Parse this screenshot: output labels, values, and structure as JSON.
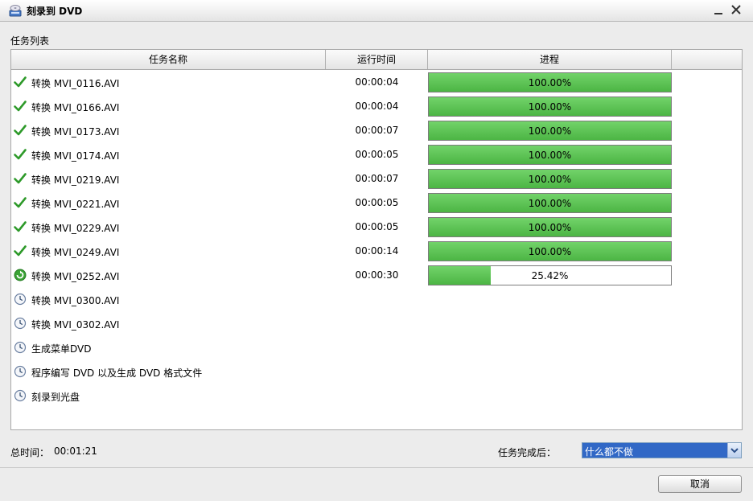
{
  "window": {
    "title": "刻录到 DVD"
  },
  "task_list": {
    "label": "任务列表",
    "columns": [
      "任务名称",
      "运行时间",
      "进程",
      ""
    ],
    "rows": [
      {
        "status": "done-check-icon",
        "name": "转换 MVI_0116.AVI",
        "time": "00:00:04",
        "progress": 100,
        "progress_text": "100.00%"
      },
      {
        "status": "done-check-icon",
        "name": "转换 MVI_0166.AVI",
        "time": "00:00:04",
        "progress": 100,
        "progress_text": "100.00%"
      },
      {
        "status": "done-check-icon",
        "name": "转换 MVI_0173.AVI",
        "time": "00:00:07",
        "progress": 100,
        "progress_text": "100.00%"
      },
      {
        "status": "done-check-icon",
        "name": "转换 MVI_0174.AVI",
        "time": "00:00:05",
        "progress": 100,
        "progress_text": "100.00%"
      },
      {
        "status": "done-check-icon",
        "name": "转换 MVI_0219.AVI",
        "time": "00:00:07",
        "progress": 100,
        "progress_text": "100.00%"
      },
      {
        "status": "done-check-icon",
        "name": "转换 MVI_0221.AVI",
        "time": "00:00:05",
        "progress": 100,
        "progress_text": "100.00%"
      },
      {
        "status": "done-check-icon",
        "name": "转换 MVI_0229.AVI",
        "time": "00:00:05",
        "progress": 100,
        "progress_text": "100.00%"
      },
      {
        "status": "done-check-icon",
        "name": "转换 MVI_0249.AVI",
        "time": "00:00:14",
        "progress": 100,
        "progress_text": "100.00%"
      },
      {
        "status": "running-refresh-icon",
        "name": "转换 MVI_0252.AVI",
        "time": "00:00:30",
        "progress": 25.42,
        "progress_text": "25.42%"
      },
      {
        "status": "pending-clock-icon",
        "name": "转换 MVI_0300.AVI",
        "time": "",
        "progress": null,
        "progress_text": ""
      },
      {
        "status": "pending-clock-icon",
        "name": "转换 MVI_0302.AVI",
        "time": "",
        "progress": null,
        "progress_text": ""
      },
      {
        "status": "pending-clock-icon",
        "name": "生成菜单DVD",
        "time": "",
        "progress": null,
        "progress_text": ""
      },
      {
        "status": "pending-clock-icon",
        "name": "程序编写 DVD 以及生成 DVD 格式文件",
        "time": "",
        "progress": null,
        "progress_text": ""
      },
      {
        "status": "pending-clock-icon",
        "name": "刻录到光盘",
        "time": "",
        "progress": null,
        "progress_text": ""
      }
    ]
  },
  "footer": {
    "total_label": "总时间：",
    "total_value": "00:01:21",
    "after_label": "任务完成后：",
    "after_value": "什么都不做",
    "cancel_label": "取消"
  },
  "colors": {
    "progress_fill": "#5cc354",
    "select_highlight": "#3168c6"
  }
}
